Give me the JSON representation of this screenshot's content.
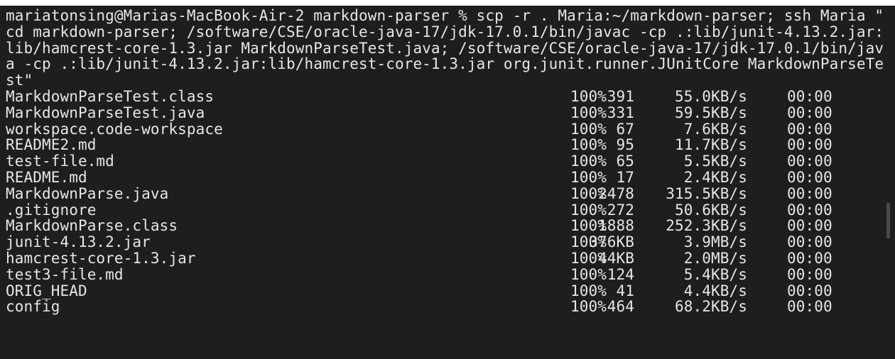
{
  "command_lines": [
    "mariatonsing@Marias-MacBook-Air-2 markdown-parser % scp -r . Maria:~/markdown-parser; ssh Maria \"",
    "cd markdown-parser; /software/CSE/oracle-java-17/jdk-17.0.1/bin/javac -cp .:lib/junit-4.13.2.jar:",
    "lib/hamcrest-core-1.3.jar MarkdownParseTest.java; /software/CSE/oracle-java-17/jdk-17.0.1/bin/jav",
    "a -cp .:lib/junit-4.13.2.jar:lib/hamcrest-core-1.3.jar org.junit.runner.JUnitCore MarkdownParseTe",
    "st\""
  ],
  "transfers": [
    {
      "name": "MarkdownParseTest.class",
      "pct": "100%",
      "size": "391",
      "speed": "55.0KB/s",
      "time": "00:00"
    },
    {
      "name": "MarkdownParseTest.java",
      "pct": "100%",
      "size": "331",
      "speed": "59.5KB/s",
      "time": "00:00"
    },
    {
      "name": "workspace.code-workspace",
      "pct": "100%",
      "size": "67",
      "speed": "7.6KB/s",
      "time": "00:00"
    },
    {
      "name": "README2.md",
      "pct": "100%",
      "size": "95",
      "speed": "11.7KB/s",
      "time": "00:00"
    },
    {
      "name": "test-file.md",
      "pct": "100%",
      "size": "65",
      "speed": "5.5KB/s",
      "time": "00:00"
    },
    {
      "name": "README.md",
      "pct": "100%",
      "size": "17",
      "speed": "2.4KB/s",
      "time": "00:00"
    },
    {
      "name": "MarkdownParse.java",
      "pct": "100%",
      "size": "2478",
      "speed": "315.5KB/s",
      "time": "00:00"
    },
    {
      "name": ".gitignore",
      "pct": "100%",
      "size": "272",
      "speed": "50.6KB/s",
      "time": "00:00"
    },
    {
      "name": "MarkdownParse.class",
      "pct": "100%",
      "size": "1888",
      "speed": "252.3KB/s",
      "time": "00:00"
    },
    {
      "name": "junit-4.13.2.jar",
      "pct": "100%",
      "size": "376KB",
      "speed": "3.9MB/s",
      "time": "00:00"
    },
    {
      "name": "hamcrest-core-1.3.jar",
      "pct": "100%",
      "size": "44KB",
      "speed": "2.0MB/s",
      "time": "00:00"
    },
    {
      "name": "test3-file.md",
      "pct": "100%",
      "size": "124",
      "speed": "5.4KB/s",
      "time": "00:00"
    },
    {
      "name": "ORIG_HEAD",
      "pct": "100%",
      "size": "41",
      "speed": "4.4KB/s",
      "time": "00:00"
    },
    {
      "name": "config",
      "pct": "100%",
      "size": "464",
      "speed": "68.2KB/s",
      "time": "00:00"
    }
  ],
  "colors": {
    "background": "#1e1e1e",
    "text": "#e6e6e6"
  }
}
